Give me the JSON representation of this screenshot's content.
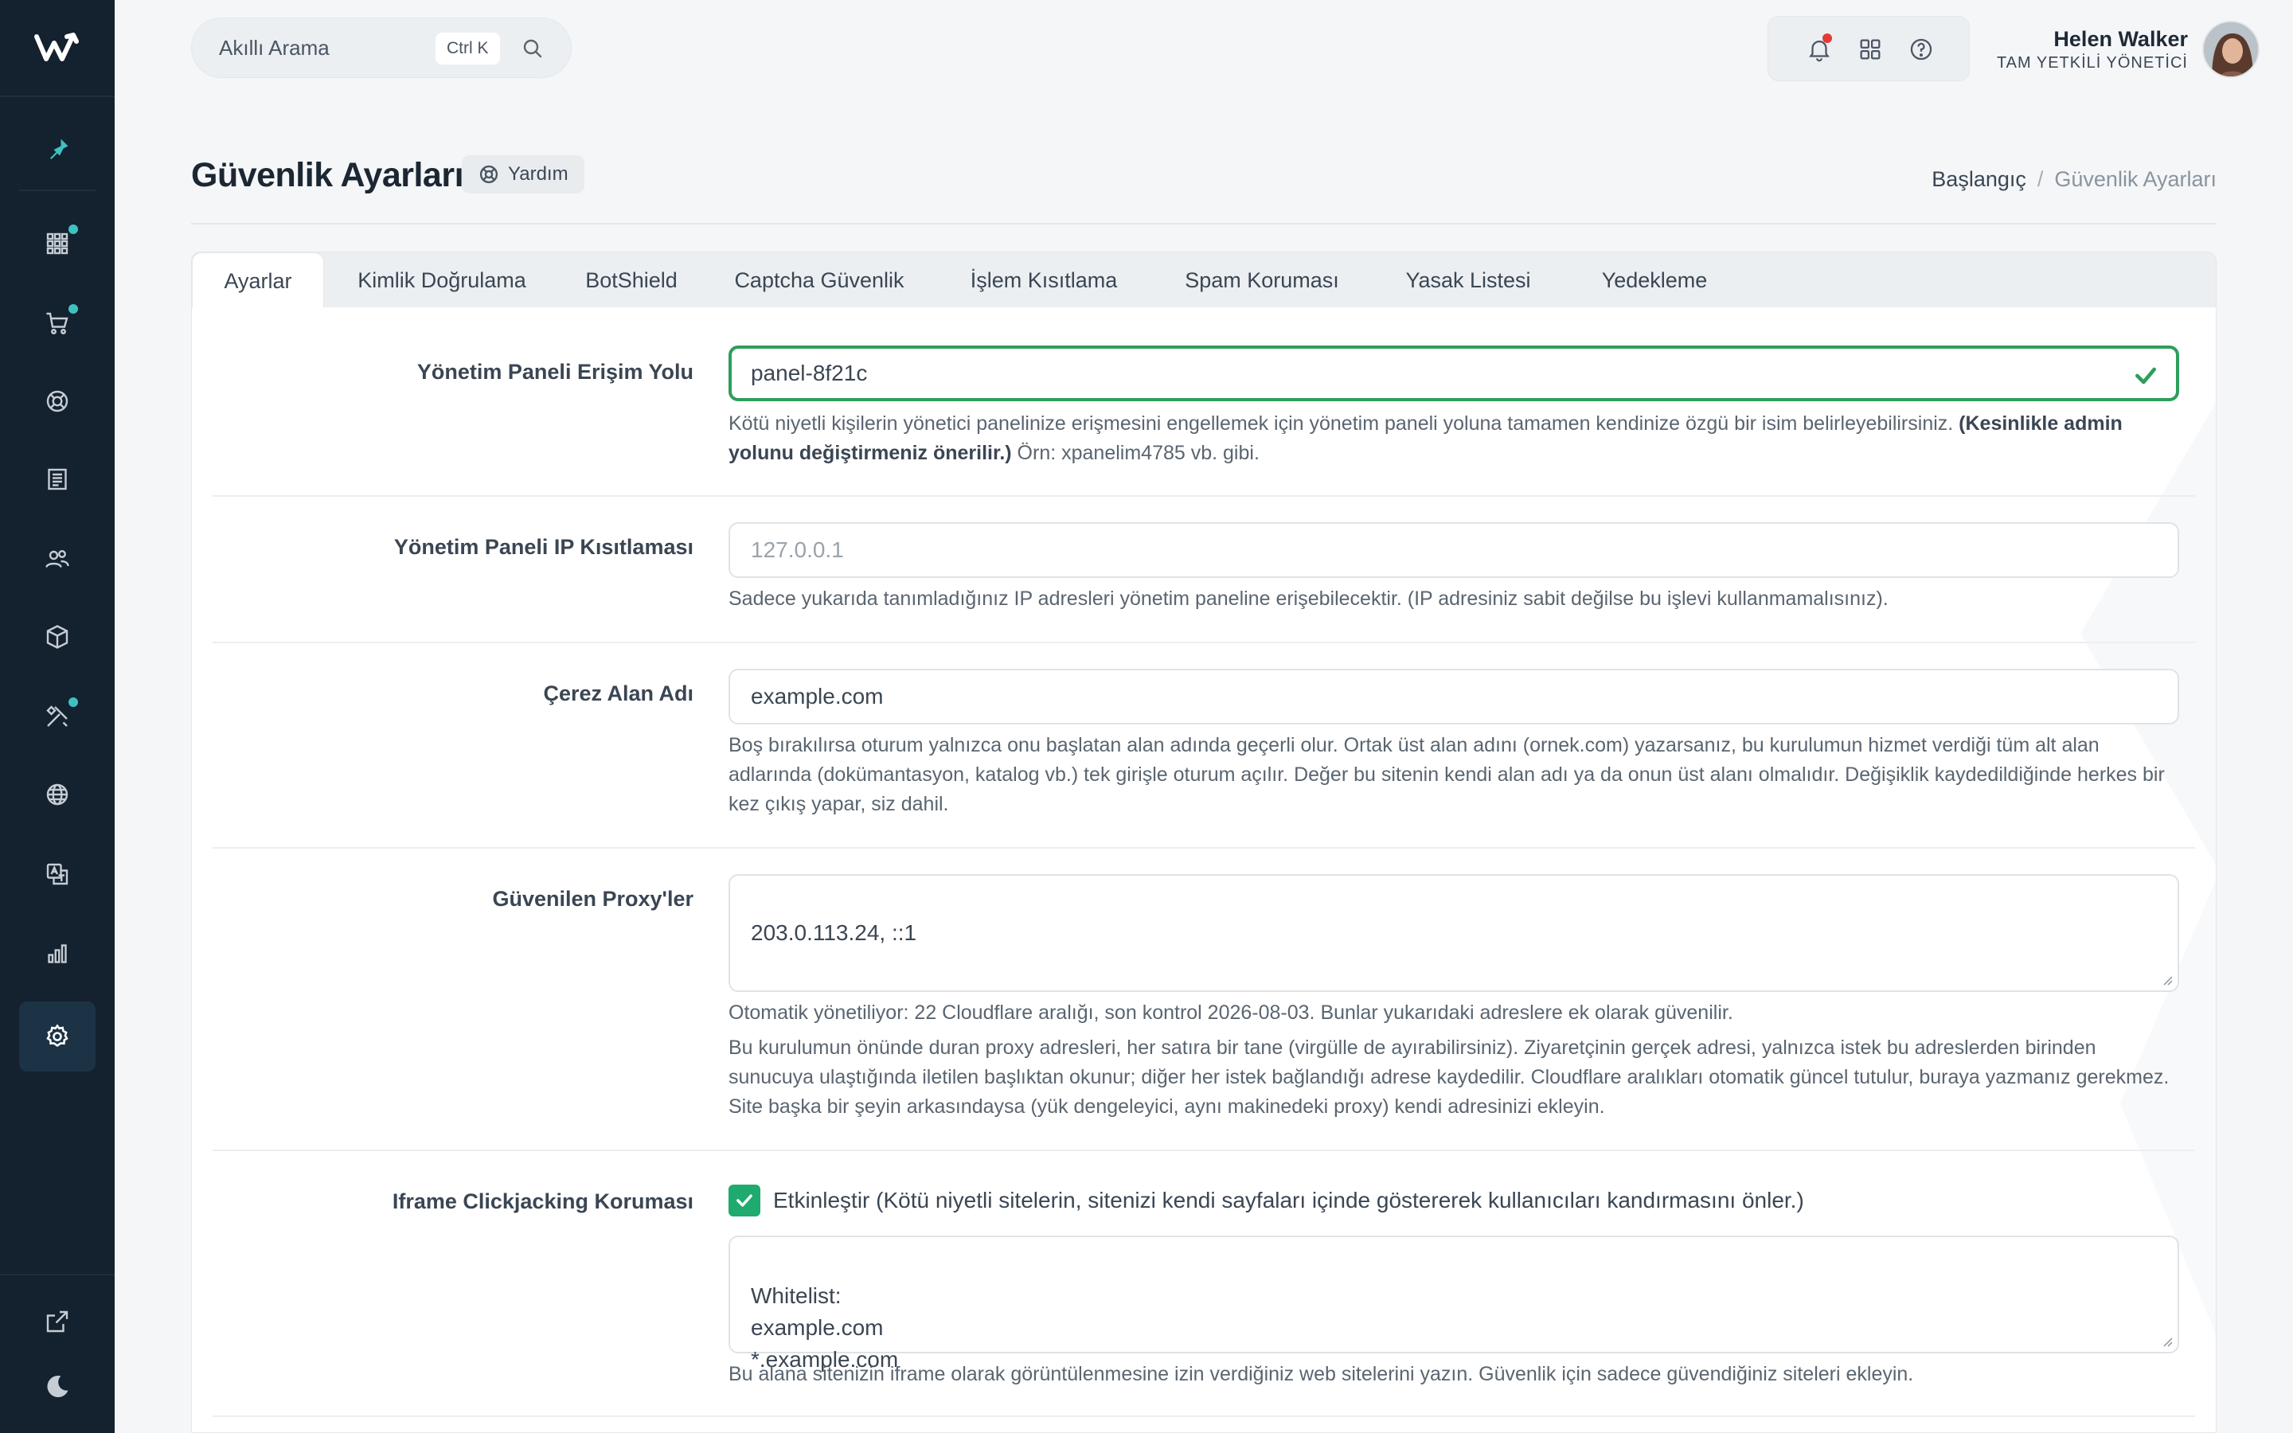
{
  "search": {
    "label": "Akıllı Arama",
    "shortcut": "Ctrl K"
  },
  "user": {
    "name": "Helen Walker",
    "role": "TAM YETKİLİ YÖNETİCİ"
  },
  "page": {
    "title": "Güvenlik Ayarları",
    "help_label": "Yardım"
  },
  "breadcrumb": {
    "home": "Başlangıç",
    "separator": "/",
    "current": "Güvenlik Ayarları"
  },
  "tabs": [
    {
      "label": "Ayarlar"
    },
    {
      "label": "Kimlik Doğrulama"
    },
    {
      "label": "BotShield"
    },
    {
      "label": "Captcha Güvenlik"
    },
    {
      "label": "İşlem Kısıtlama"
    },
    {
      "label": "Spam Koruması"
    },
    {
      "label": "Yasak Listesi"
    },
    {
      "label": "Yedekleme"
    }
  ],
  "fields": {
    "admin_path": {
      "label": "Yönetim Paneli Erişim Yolu",
      "value": "panel-8f21c",
      "help_start": "Kötü niyetli kişilerin yönetici panelinize erişmesini engellemek için yönetim paneli yoluna tamamen kendinize özgü bir isim belirleyebilirsiniz. ",
      "help_bold": "(Kesinlikle admin yolunu değiştirmeniz önerilir.)",
      "help_end": " Örn: xpanelim4785 vb. gibi."
    },
    "ip_restriction": {
      "label": "Yönetim Paneli IP Kısıtlaması",
      "placeholder": "127.0.0.1",
      "help": "Sadece yukarıda tanımladığınız IP adresleri yönetim paneline erişebilecektir. (IP adresiniz sabit değilse bu işlevi kullanmamalısınız)."
    },
    "cookie_domain": {
      "label": "Çerez Alan Adı",
      "value": "example.com",
      "help": "Boş bırakılırsa oturum yalnızca onu başlatan alan adında geçerli olur. Ortak üst alan adını (ornek.com) yazarsanız, bu kurulumun hizmet verdiği tüm alt alan adlarında (dokümantasyon, katalog vb.) tek girişle oturum açılır. Değer bu sitenin kendi alan adı ya da onun üst alanı olmalıdır. Değişiklik kaydedildiğinde herkes bir kez çıkış yapar, siz dahil."
    },
    "trusted_proxies": {
      "label": "Güvenilen Proxy'ler",
      "value": "203.0.113.24, ::1",
      "auto_note": "Otomatik yönetiliyor: 22 Cloudflare aralığı, son kontrol 2026-08-03. Bunlar yukarıdaki adreslere ek olarak güvenilir.",
      "help": "Bu kurulumun önünde duran proxy adresleri, her satıra bir tane (virgülle de ayırabilirsiniz). Ziyaretçinin gerçek adresi, yalnızca istek bu adreslerden birinden sunucuya ulaştığında iletilen başlıktan okunur; diğer her istek bağlandığı adrese kaydedilir. Cloudflare aralıkları otomatik güncel tutulur, buraya yazmanız gerekmez. Site başka bir şeyin arkasındaysa (yük dengeleyici, aynı makinedeki proxy) kendi adresinizi ekleyin."
    },
    "clickjacking": {
      "label": "Iframe Clickjacking Koruması",
      "checkbox_label": "Etkinleştir (Kötü niyetli sitelerin, sitenizi kendi sayfaları içinde göstererek kullanıcıları kandırmasını önler.)",
      "checked": true,
      "whitelist": "Whitelist:\nexample.com\n*.example.com",
      "help": "Bu alana sitenizin iframe olarak görüntülenmesine izin verdiğiniz web sitelerini yazın. Güvenlik için sadece güvendiğiniz siteleri ekleyin."
    }
  },
  "icons": {
    "sidebar": [
      "pin-icon",
      "apps-icon",
      "cart-icon",
      "support-icon",
      "receipt-icon",
      "users-icon",
      "box-icon",
      "tools-icon",
      "globe-icon",
      "translate-icon",
      "chart-icon",
      "gear-icon"
    ],
    "sidebar_bottom": [
      "external-link-icon",
      "moon-icon"
    ],
    "topbar": [
      "bell-icon",
      "grid-icon",
      "help-circle-icon"
    ]
  },
  "colors": {
    "sidebar_bg": "#14212e",
    "accent": "#3ec1c1",
    "success": "#2e9e5b",
    "checkbox": "#1faa6e",
    "notification": "#e53935"
  }
}
